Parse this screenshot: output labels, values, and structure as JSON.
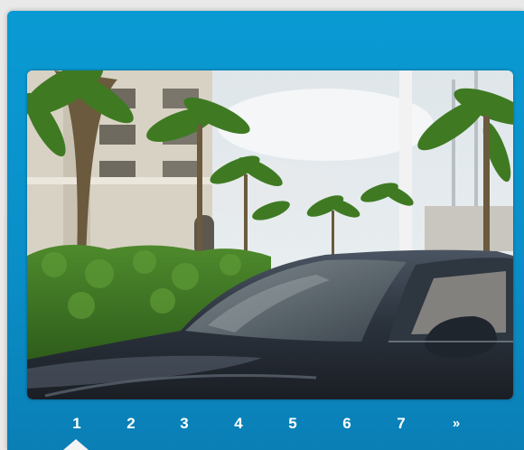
{
  "slideshow": {
    "image_alt": "",
    "pager": {
      "pages": [
        "1",
        "2",
        "3",
        "4",
        "5",
        "6",
        "7"
      ],
      "next_label": "»",
      "active_page": "1"
    }
  },
  "colors": {
    "frame": "#0a8fc8",
    "page_link": "#ffffff",
    "pointer": "#f4f4f4"
  }
}
